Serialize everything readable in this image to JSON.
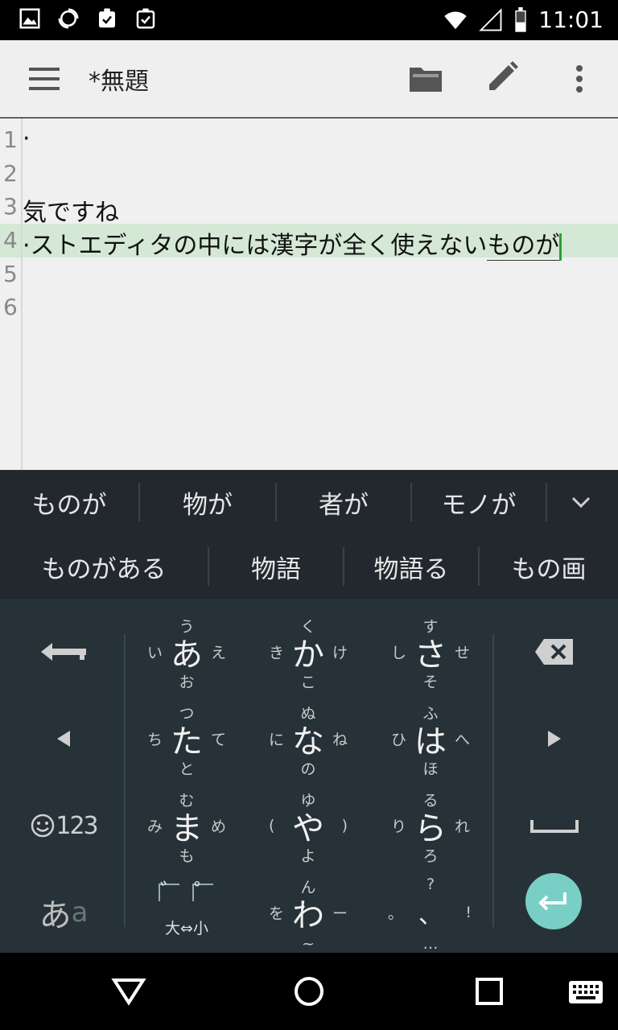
{
  "status": {
    "time": "11:01",
    "icons": [
      "image-icon",
      "sync-icon",
      "clipboard-check-icon",
      "clipboard-check-icon",
      "wifi-icon",
      "signal-icon",
      "battery-icon"
    ]
  },
  "appbar": {
    "title": "*無題",
    "icons": [
      "menu-icon",
      "folder-icon",
      "pencil-icon",
      "more-vert-icon"
    ]
  },
  "editor": {
    "line_numbers": [
      "1",
      "2",
      "3",
      "4",
      "5",
      "6"
    ],
    "lines": {
      "l1": "·",
      "l2": "",
      "l3": "気ですね",
      "l4_prefix": "·ストエディタの中には漢字が全く使えない",
      "l4_composing": "ものが",
      "l5": "",
      "l6": ""
    }
  },
  "candidates": {
    "row1": [
      "ものが",
      "物が",
      "者が",
      "モノが"
    ],
    "row2": [
      "ものがある",
      "物語",
      "物語る",
      "もの画"
    ]
  },
  "keyboard": {
    "keys": {
      "a": {
        "main": "あ",
        "top": "う",
        "bottom": "お",
        "left": "い",
        "right": "え"
      },
      "ka": {
        "main": "か",
        "top": "く",
        "bottom": "こ",
        "left": "き",
        "right": "け"
      },
      "sa": {
        "main": "さ",
        "top": "す",
        "bottom": "そ",
        "left": "し",
        "right": "せ"
      },
      "ta": {
        "main": "た",
        "top": "つ",
        "bottom": "と",
        "left": "ち",
        "right": "て"
      },
      "na": {
        "main": "な",
        "top": "ぬ",
        "bottom": "の",
        "left": "に",
        "right": "ね"
      },
      "ha": {
        "main": "は",
        "top": "ふ",
        "bottom": "ほ",
        "left": "ひ",
        "right": "へ"
      },
      "ma": {
        "main": "ま",
        "top": "む",
        "bottom": "も",
        "left": "み",
        "right": "め"
      },
      "ya": {
        "main": "や",
        "top": "ゆ",
        "bottom": "よ",
        "left": "(",
        "right": ")"
      },
      "ra": {
        "main": "ら",
        "top": "る",
        "bottom": "ろ",
        "left": "り",
        "right": "れ"
      },
      "wa": {
        "main": "わ",
        "top": "ん",
        "bottom": "~",
        "left": "を",
        "right": "ー"
      },
      "punct": {
        "top": "?",
        "bottom": "…",
        "left": "。",
        "center": "、",
        "right": "!"
      },
      "dakuten": {
        "top_left": "゛",
        "top_right": "゜",
        "bottom": "大⇔小"
      }
    },
    "emoji_num_label": "123",
    "mode_label_main": "あ",
    "mode_label_sub": "a",
    "colors": {
      "accent": "#79cfc6",
      "keyboard_bg": "#263238",
      "candidate_bg": "#22282e"
    }
  },
  "navbar": {
    "icons": [
      "back-icon",
      "home-icon",
      "recents-icon",
      "keyboard-icon"
    ]
  }
}
